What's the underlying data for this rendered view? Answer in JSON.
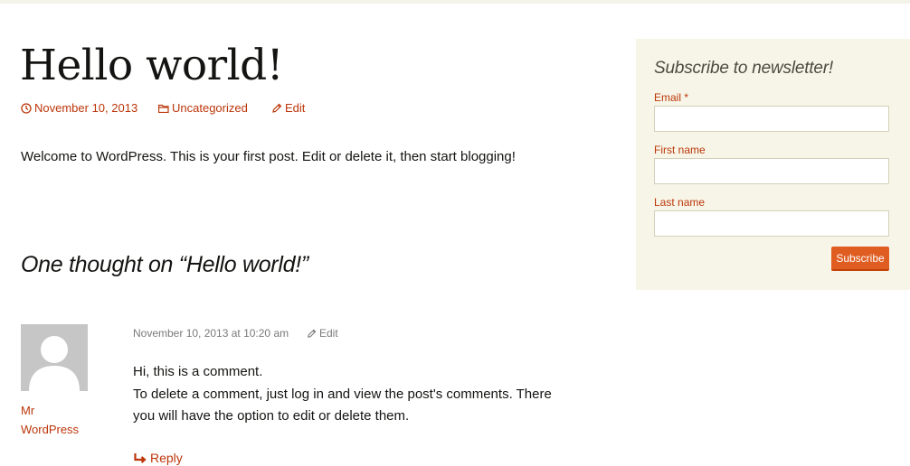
{
  "post": {
    "title": "Hello world!",
    "date": "November 10, 2013",
    "category": "Uncategorized",
    "edit_label": "Edit",
    "content": "Welcome to WordPress. This is your first post. Edit or delete it, then start blogging!"
  },
  "comments": {
    "title": "One thought on “Hello world!”",
    "items": [
      {
        "author_line1": "Mr",
        "author_line2": "WordPress",
        "datetime": "November 10, 2013 at 10:20 am",
        "edit_label": "Edit",
        "text_line1": "Hi, this is a comment.",
        "text_line2": "To delete a comment, just log in and view the post's comments. There you will have the option to edit or delete them.",
        "reply_label": "Reply"
      }
    ]
  },
  "newsletter": {
    "title": "Subscribe to newsletter!",
    "email_label": "Email *",
    "first_name_label": "First name",
    "last_name_label": "Last name",
    "email_value": "",
    "first_name_value": "",
    "last_name_value": "",
    "submit_label": "Subscribe"
  },
  "colors": {
    "accent": "#bc360a",
    "button": "#e05d22",
    "widget_bg": "#f7f5e7"
  },
  "icons": {
    "date": "clock-icon",
    "category": "folder-icon",
    "edit": "pencil-icon",
    "reply": "reply-arrow-icon"
  }
}
